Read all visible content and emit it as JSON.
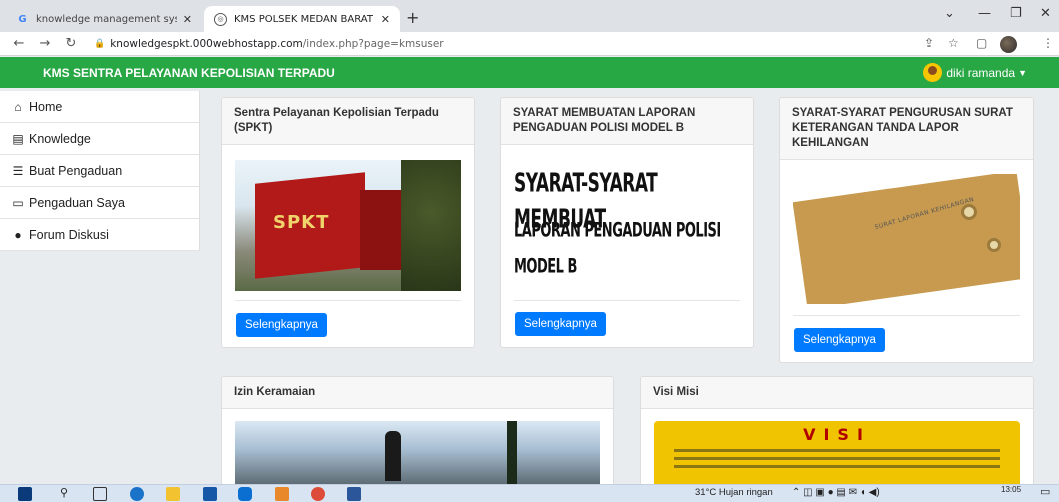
{
  "browser": {
    "tabs": [
      {
        "label": "knowledge management system",
        "icon": "google-icon"
      },
      {
        "label": "KMS POLSEK MEDAN BARAT",
        "icon": "site-favicon"
      }
    ],
    "new_tab": "+",
    "url_host": "knowledgespkt.000webhostapp.com",
    "url_path": "/index.php?page=kmsuser"
  },
  "app": {
    "brand": "KMS SENTRA PELAYANAN KEPOLISIAN TERPADU",
    "user_name": "diki ramanda",
    "accent": "#28a745",
    "button_color": "#007bff"
  },
  "sidebar": {
    "items": [
      {
        "label": "Home",
        "icon": "home-icon"
      },
      {
        "label": "Knowledge",
        "icon": "book-icon"
      },
      {
        "label": "Buat Pengaduan",
        "icon": "list-icon"
      },
      {
        "label": "Pengaduan Saya",
        "icon": "chalkboard-icon"
      },
      {
        "label": "Forum Diskusi",
        "icon": "comment-icon"
      }
    ]
  },
  "cards": [
    {
      "title": "Sentra Pelayanan Kepolisian Terpadu (SPKT)",
      "button": "Selengkapnya",
      "image_text": "SPKT"
    },
    {
      "title": "SYARAT MEMBUATAN LAPORAN PENGADUAN POLISI MODEL B",
      "button": "Selengkapnya",
      "image_text_1": "SYARAT-SYARAT MEMBUAT",
      "image_text_2": "LAPORAN PENGADUAN POLISI MODEL B"
    },
    {
      "title": "SYARAT-SYARAT PENGURUSAN SURAT KETERANGAN TANDA LAPOR KEHILANGAN",
      "button": "Selengkapnya",
      "image_text": "SURAT LAPORAN KEHILANGAN"
    },
    {
      "title": "Izin Keramaian"
    },
    {
      "title": "Visi Misi",
      "image_text": "VISI"
    }
  ],
  "taskbar": {
    "weather": "31°C  Hujan ringan",
    "time": "13:05"
  }
}
